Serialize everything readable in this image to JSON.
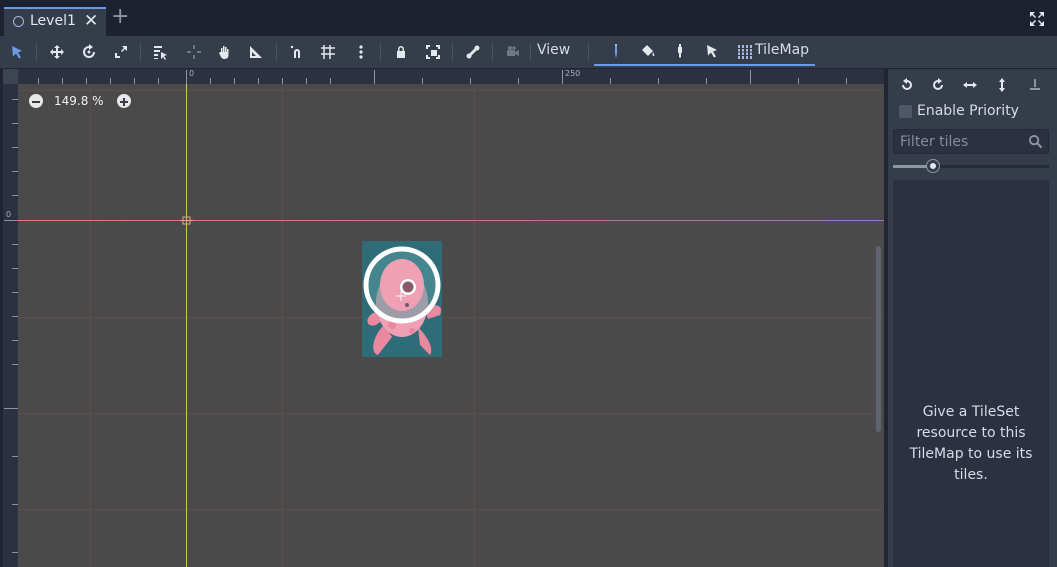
{
  "tab": {
    "label": "Level1",
    "close": "✕",
    "add": "+"
  },
  "toolbar": {
    "icons": [
      "select-icon",
      "move-icon",
      "rotate-icon",
      "scale-icon",
      "list-select-icon",
      "pivot-icon",
      "pan-icon",
      "ruler-icon",
      "smart-snap-icon",
      "grid-snap-icon",
      "more-icon",
      "lock-icon",
      "group-icon",
      "skeleton-icon",
      "camera-icon"
    ],
    "view_label": "View",
    "tilemap_label": "TileMap"
  },
  "viewport": {
    "zoom_level": "149.8 %",
    "ruler_top_labels": [
      "0",
      "250"
    ],
    "ruler_left_labels": [
      "0"
    ]
  },
  "panel": {
    "enable_priority_label": "Enable Priority",
    "filter_placeholder": "Filter tiles",
    "empty_message": "Give a TileSet resource to this TileMap to use its tiles."
  },
  "colors": {
    "accent": "#699ce8",
    "bg": "#202531",
    "panel": "#363d4a",
    "canvas": "#4a4a4a"
  }
}
